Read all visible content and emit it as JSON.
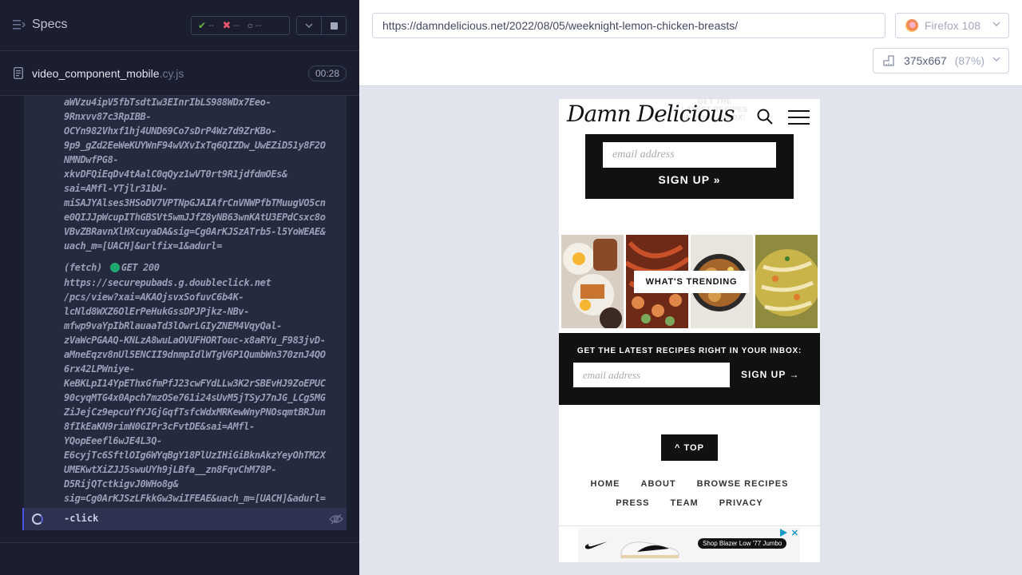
{
  "reporter": {
    "specs_label": "Specs",
    "stats": {
      "passed": "--",
      "failed": "--",
      "pending": "--"
    },
    "spec_file": {
      "name": "video_component_mobile",
      "ext": ".cy.js",
      "duration": "00:28"
    },
    "log_block_1": "aWVzu4ipV5fbTsdtIw3EInrIbLS988WDx7Eeo-\n9Rnxvv87c3RpIBB-\nOCYn982Vhxf1hj4UND69Co7sDrP4Wz7d9ZrKBo-\n9p9_gZd2EeWeKUYWnF94wVXvIxTq6QIZDw_UwEZiD51y8F2O\nNMNDwfPG8-\nxkvDFQiEqDv4tAalC0qQyz1wVT0rt9R1jdfdmOEs&\nsai=AMfl-YTjlr31bU-\nmiSAJYAlses3HSoDV7VPTNpGJAIAfrCnVNWPfbTMuugVO5cn\ne0QIJJpWcupIThGBSVt5wmJJfZ8yNB63wnKAtU3EPdCsxc8o\nVBvZBRavnXlHXcuyaDA&sig=Cg0ArKJSzATrb5-l5YoWEAE&\nuach_m=[UACH]&urlfix=1&adurl=",
    "fetch": {
      "label": "(fetch)",
      "request": "GET 200"
    },
    "log_block_2": "https://securepubads.g.doubleclick.net\n/pcs/view?xai=AKAOjsvxSofuvC6b4K-\nlcNld8WXZ6OlErPeHukGssDPJPjkz-NBv-\nmfwp9vaYpIbRlauaaTd3lOwrLGIyZNEM4VqyQal-\nzVaWcPGAAQ-KNLzA8wuLaOVUFHORTouc-x8aRYu_F983jvD-\naMneEqzv8nUl5ENCII9dnmpIdlWTgV6P1QumbWn370znJ4QO\n6rx42LPWniye-\nKeBKLpI14YpEThxGfmPfJ23cwFYdLLw3K2rSBEvHJ9ZoEPUC\n90cyqMTG4x0Apch7mzOSe761i24sUvM5jTSyJ7nJG_LCg5MG\nZiJejCz9epcuYfYJGjGqfTsfcWdxMRKewWnyPNOsqmtBRJun\n8fIkEaKN9rimN0GIPr3cFvtDE&sai=AMfl-\nYQopEeefl6wJE4L3Q-\nE6cyjTc6SftlOIg6WYqBgY18PlUzIHiGiBknAkzYeyOhTM2X\nUMEKwtXiZJJ5swuUYh9jLBfa__zn8FqvChM78P-\nD5RijQTctkigvJ0WHo8g&\nsig=Cg0ArKJSzLFkkGw3wiIFEAE&uach_m=[UACH]&adurl=",
    "active_command": "-click"
  },
  "aut": {
    "url": "https://damndelicious.net/2022/08/05/weeknight-lemon-chicken-breasts/",
    "browser": "Firefox 108",
    "viewport": "375x667",
    "zoom": "(87%)"
  },
  "mobile_page": {
    "ghost_header": "GET THE\nLATEST RECIPES\nIN YOUR INBOX:",
    "logo": "Damn Delicious",
    "signup_box": {
      "placeholder": "email address",
      "button": "SIGN UP »"
    },
    "trending_label": "WHAT'S TRENDING",
    "newsletter": {
      "title": "GET THE LATEST RECIPES RIGHT IN YOUR INBOX:",
      "placeholder": "email address",
      "button": "SIGN UP →"
    },
    "top_button": "^ TOP",
    "footer_row_1": [
      "HOME",
      "ABOUT",
      "BROWSE RECIPES"
    ],
    "footer_row_2": [
      "PRESS",
      "TEAM",
      "PRIVACY"
    ],
    "ad": {
      "cta": "Shop Blazer Low '77 Jumbo"
    }
  },
  "colors": {
    "reporter_bg": "#1b1e2e",
    "passed": "#69b73f",
    "failed": "#e45770",
    "request_ok": "#1fa971",
    "active_accent": "#4956e3"
  }
}
